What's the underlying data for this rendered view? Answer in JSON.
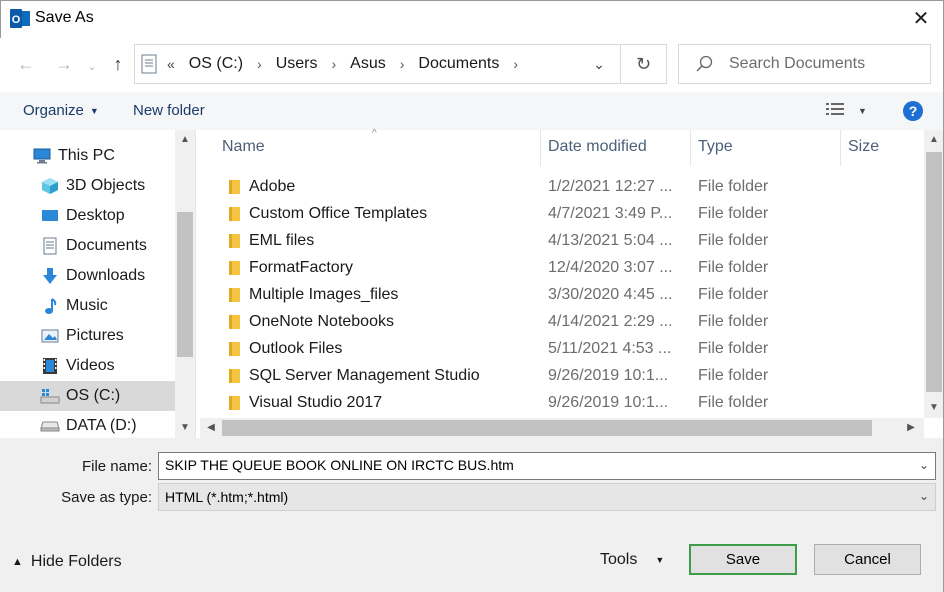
{
  "window": {
    "title": "Save As"
  },
  "address": {
    "overflow": "«",
    "crumbs": [
      "OS (C:)",
      "Users",
      "Asus",
      "Documents"
    ]
  },
  "search": {
    "placeholder": "Search Documents"
  },
  "toolbar": {
    "organize_label": "Organize",
    "new_folder_label": "New folder",
    "help_label": "?"
  },
  "nav": {
    "items": [
      {
        "label": "This PC",
        "icon": "pc-icon"
      },
      {
        "label": "3D Objects",
        "icon": "3d-objects-icon"
      },
      {
        "label": "Desktop",
        "icon": "desktop-icon"
      },
      {
        "label": "Documents",
        "icon": "documents-icon"
      },
      {
        "label": "Downloads",
        "icon": "downloads-icon"
      },
      {
        "label": "Music",
        "icon": "music-icon"
      },
      {
        "label": "Pictures",
        "icon": "pictures-icon"
      },
      {
        "label": "Videos",
        "icon": "videos-icon"
      },
      {
        "label": "OS (C:)",
        "icon": "windows-drive-icon",
        "selected": true
      },
      {
        "label": "DATA (D:)",
        "icon": "drive-icon"
      }
    ]
  },
  "columns": {
    "name": "Name",
    "date": "Date modified",
    "type": "Type",
    "size": "Size"
  },
  "files": [
    {
      "name": "Adobe",
      "date": "1/2/2021 12:27 ...",
      "type": "File folder"
    },
    {
      "name": "Custom Office Templates",
      "date": "4/7/2021 3:49 P...",
      "type": "File folder"
    },
    {
      "name": "EML files",
      "date": "4/13/2021 5:04 ...",
      "type": "File folder"
    },
    {
      "name": "FormatFactory",
      "date": "12/4/2020 3:07 ...",
      "type": "File folder"
    },
    {
      "name": "Multiple Images_files",
      "date": "3/30/2020 4:45 ...",
      "type": "File folder"
    },
    {
      "name": "OneNote Notebooks",
      "date": "4/14/2021 2:29 ...",
      "type": "File folder"
    },
    {
      "name": "Outlook Files",
      "date": "5/11/2021 4:53 ...",
      "type": "File folder"
    },
    {
      "name": "SQL Server Management Studio",
      "date": "9/26/2019 10:1...",
      "type": "File folder"
    },
    {
      "name": "Visual Studio 2017",
      "date": "9/26/2019 10:1...",
      "type": "File folder"
    }
  ],
  "form": {
    "file_name_label": "File name:",
    "file_name_value": "SKIP THE QUEUE BOOK ONLINE ON IRCTC BUS.htm",
    "save_type_label": "Save as type:",
    "save_type_value": "HTML (*.htm;*.html)"
  },
  "footer": {
    "hide_folders_label": "Hide Folders",
    "tools_label": "Tools",
    "save_label": "Save",
    "cancel_label": "Cancel"
  },
  "colors": {
    "accent": "#1d6fd1",
    "folder": "#f5c342",
    "save_border": "#3c9c4a"
  }
}
